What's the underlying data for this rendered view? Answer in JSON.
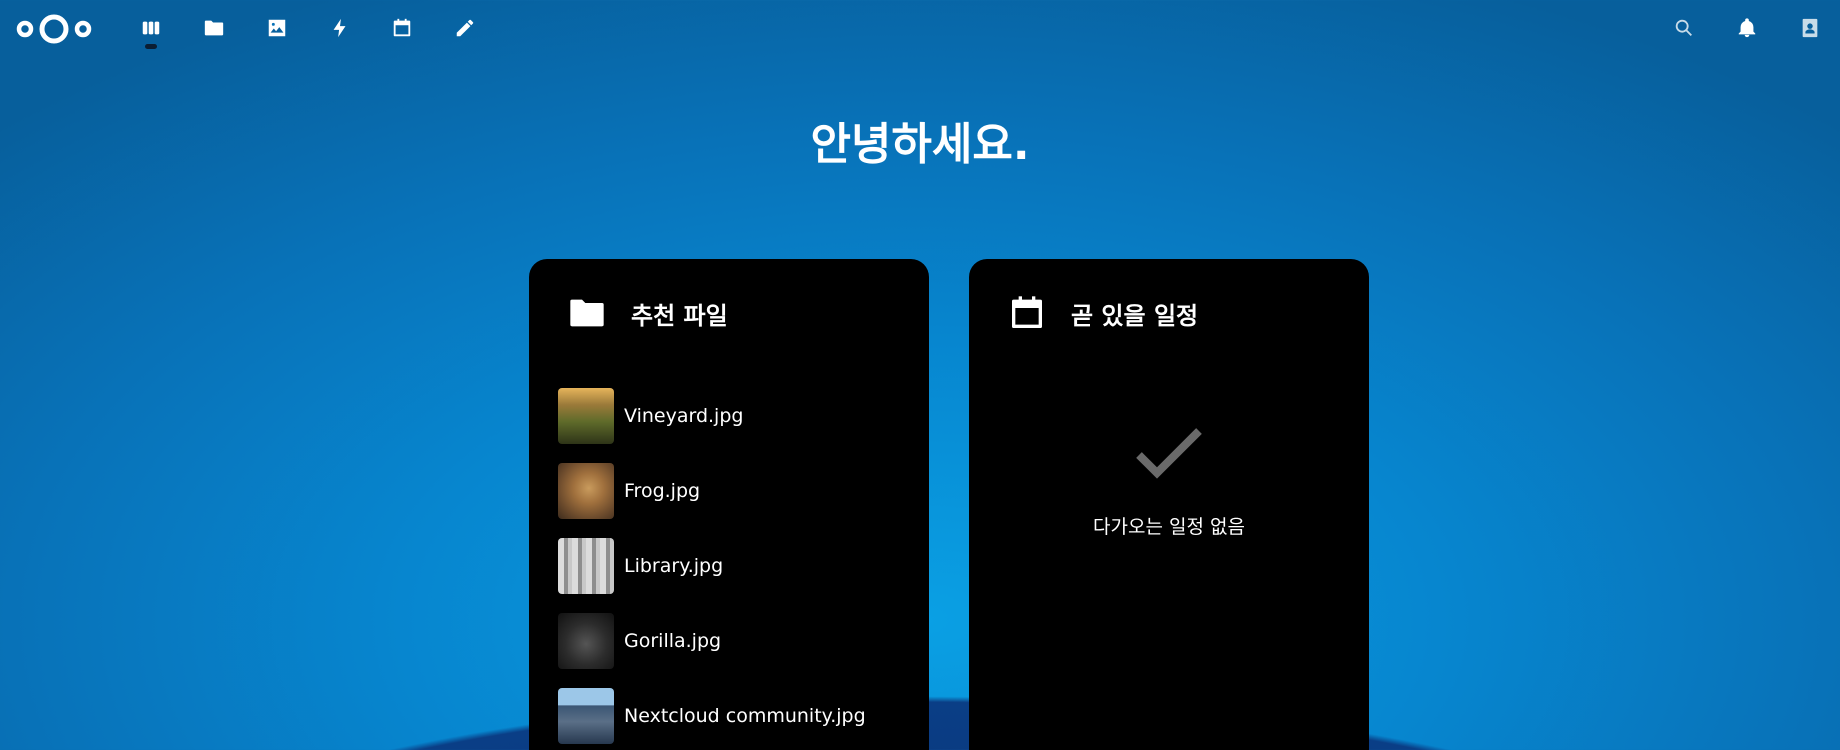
{
  "header": {
    "logo": "nextcloud-logo",
    "apps": [
      {
        "name": "dashboard",
        "icon": "dashboard-icon",
        "active": true
      },
      {
        "name": "files",
        "icon": "folder-icon"
      },
      {
        "name": "photos",
        "icon": "image-icon"
      },
      {
        "name": "activity",
        "icon": "lightning-icon"
      },
      {
        "name": "calendar",
        "icon": "calendar-icon"
      },
      {
        "name": "notes",
        "icon": "pencil-icon"
      }
    ],
    "right": [
      {
        "name": "search",
        "icon": "search-icon"
      },
      {
        "name": "notifications",
        "icon": "bell-icon"
      },
      {
        "name": "contacts",
        "icon": "contacts-icon"
      }
    ]
  },
  "greeting": "안녕하세요.",
  "recommended_files": {
    "title": "추천 파일",
    "icon": "folder-icon",
    "items": [
      {
        "name": "Vineyard.jpg"
      },
      {
        "name": "Frog.jpg"
      },
      {
        "name": "Library.jpg"
      },
      {
        "name": "Gorilla.jpg"
      },
      {
        "name": "Nextcloud community.jpg"
      }
    ]
  },
  "upcoming_events": {
    "title": "곧 있을 일정",
    "icon": "calendar-icon",
    "empty_icon": "checkmark-icon",
    "empty_text": "다가오는 일정 없음"
  }
}
